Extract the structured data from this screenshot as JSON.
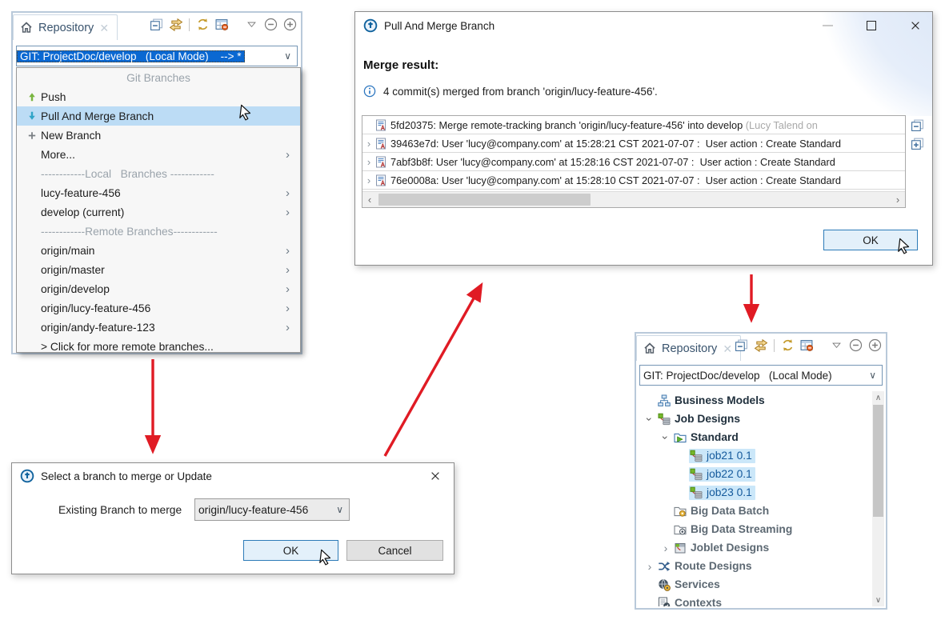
{
  "accent_colors": {
    "selection_blue": "#0a68d2",
    "menu_highlight": "#bcdcf5",
    "tree_highlight": "#cbe7f9",
    "arrow_red": "#e01b24",
    "gold_icon": "#c49a2a"
  },
  "toolbar_icons": [
    "collapse-all",
    "switch-branches",
    "separator",
    "refresh",
    "table-filter",
    "spacer",
    "view-menu",
    "minimize-view",
    "maximize-view"
  ],
  "panel_top_left": {
    "tab": "Repository",
    "combo_value": "GIT: ProjectDoc/develop   (Local Mode)    --> *",
    "menu": {
      "header": "Git Branches",
      "items": [
        {
          "label": "Push",
          "icon": "push-up-arrow"
        },
        {
          "label": "Pull And Merge Branch",
          "icon": "pull-down-arrow",
          "selected": true
        },
        {
          "label": "New Branch",
          "icon": "plus"
        },
        {
          "label": "More...",
          "submenu": true
        },
        {
          "label": "------------Local   Branches ------------",
          "separator": true
        },
        {
          "label": "lucy-feature-456",
          "submenu": true
        },
        {
          "label": "develop (current)",
          "submenu": true
        },
        {
          "label": "------------Remote Branches------------",
          "separator": true
        },
        {
          "label": "origin/main",
          "submenu": true
        },
        {
          "label": "origin/master",
          "submenu": true
        },
        {
          "label": "origin/develop",
          "submenu": true
        },
        {
          "label": "origin/lucy-feature-456",
          "submenu": true
        },
        {
          "label": "origin/andy-feature-123",
          "submenu": true
        },
        {
          "label": "> Click for more remote branches..."
        }
      ]
    }
  },
  "merge_dialog": {
    "title": "Pull And Merge Branch",
    "heading": "Merge result:",
    "info": "4 commit(s) merged from branch 'origin/lucy-feature-456'.",
    "commits": [
      {
        "text": "5fd20375: Merge remote-tracking branch 'origin/lucy-feature-456' into develop ",
        "suffix": "(Lucy Talend on",
        "expandable": false
      },
      {
        "text": "39463e7d: User 'lucy@company.com' at 15:28:21 CST 2021-07-07 :  User action : Create Standard",
        "expandable": true
      },
      {
        "text": "7abf3b8f: User 'lucy@company.com' at 15:28:16 CST 2021-07-07 :  User action : Create Standard",
        "expandable": true
      },
      {
        "text": "76e0008a: User 'lucy@company.com' at 15:28:10 CST 2021-07-07 :  User action : Create Standard",
        "expandable": true
      }
    ],
    "ok_label": "OK"
  },
  "branch_dialog": {
    "title": "Select a branch to merge or Update",
    "field_label": "Existing Branch to merge",
    "field_value": "origin/lucy-feature-456",
    "ok_label": "OK",
    "cancel_label": "Cancel"
  },
  "panel_bottom_right": {
    "tab": "Repository",
    "combo_value": "GIT: ProjectDoc/develop   (Local Mode)",
    "tree": [
      {
        "label": "Business Models",
        "icon": "business-models",
        "indent": 1,
        "style": "dark"
      },
      {
        "label": "Job Designs",
        "icon": "job-designs",
        "indent": 1,
        "chevron": "expanded",
        "style": "dark"
      },
      {
        "label": "Standard",
        "icon": "folder-standard",
        "indent": 2,
        "chevron": "expanded",
        "style": "dark"
      },
      {
        "label": "job21 0.1",
        "icon": "job",
        "indent": 3,
        "selected": true,
        "style": "blue"
      },
      {
        "label": "job22 0.1",
        "icon": "job",
        "indent": 3,
        "selected": true,
        "style": "blue"
      },
      {
        "label": "job23 0.1",
        "icon": "job",
        "indent": 3,
        "selected": true,
        "style": "blue"
      },
      {
        "label": "Big Data Batch",
        "icon": "folder-gear",
        "indent": 2,
        "style": "gray"
      },
      {
        "label": "Big Data Streaming",
        "icon": "folder-stream",
        "indent": 2,
        "style": "gray"
      },
      {
        "label": "Joblet Designs",
        "icon": "joblet",
        "indent": 2,
        "chevron": "collapsed",
        "style": "gray"
      },
      {
        "label": "Route Designs",
        "icon": "route",
        "indent": 1,
        "chevron": "collapsed",
        "style": "gray"
      },
      {
        "label": "Services",
        "icon": "services",
        "indent": 1,
        "style": "gray"
      },
      {
        "label": "Contexts",
        "icon": "contexts",
        "indent": 1,
        "style": "gray"
      }
    ]
  }
}
